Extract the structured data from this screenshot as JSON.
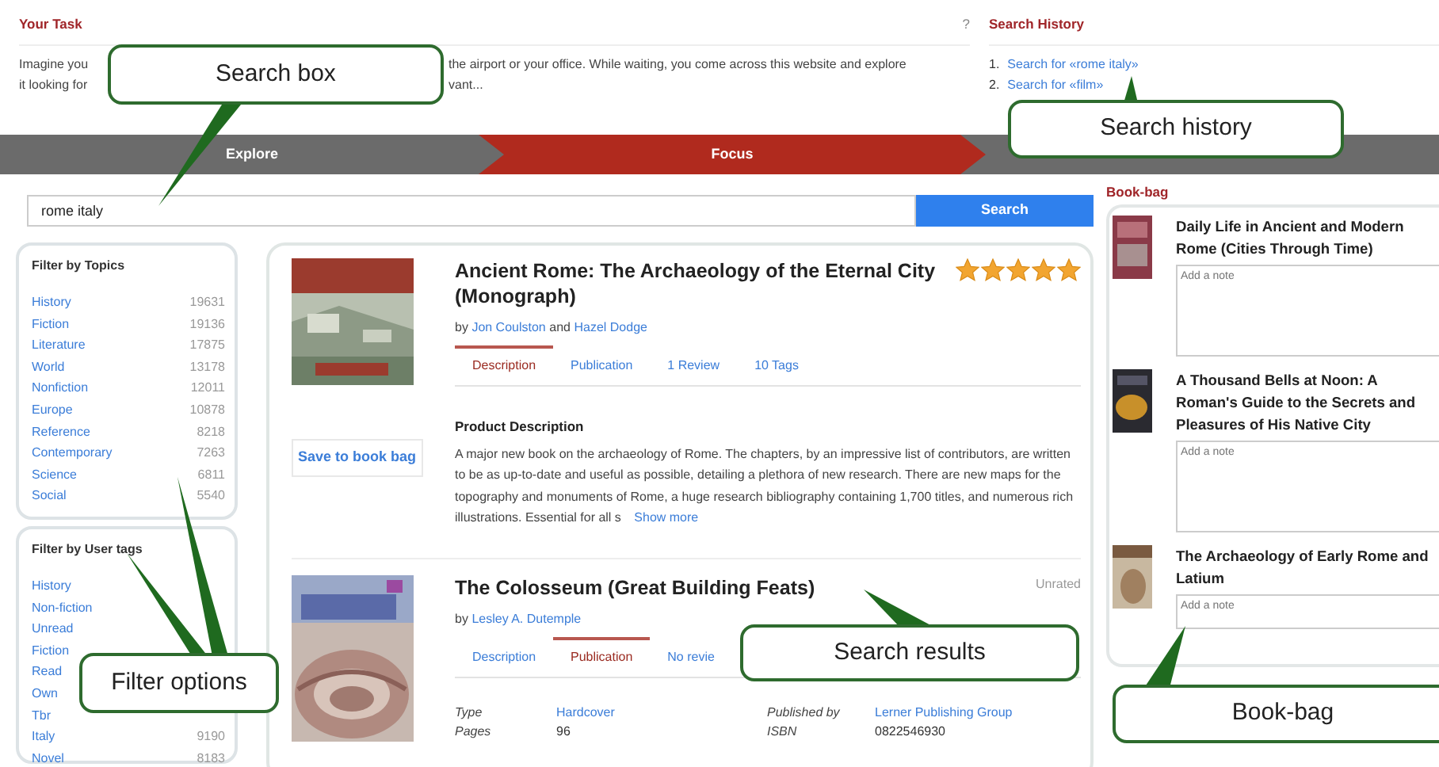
{
  "task": {
    "title": "Your Task",
    "help": "?",
    "lines": [
      {
        "before": "Imagine you",
        "after": "the airport or your office. While waiting, you come across this website and explore"
      },
      {
        "before": "it looking for",
        "after": "vant..."
      }
    ]
  },
  "search_history": {
    "title": "Search History",
    "items": [
      {
        "number": "1.",
        "label": "Search for «rome italy»"
      },
      {
        "number": "2.",
        "label": "Search for «film»"
      }
    ]
  },
  "steps": [
    {
      "label": "Explore",
      "selected": false
    },
    {
      "label": "Focus",
      "selected": true
    }
  ],
  "search": {
    "value": "rome italy",
    "button": "Search"
  },
  "filters": [
    {
      "title": "Filter by Topics",
      "items": [
        {
          "label": "History",
          "count": "19631"
        },
        {
          "label": "Fiction",
          "count": "19136"
        },
        {
          "label": "Literature",
          "count": "17875"
        },
        {
          "label": "World",
          "count": "13178"
        },
        {
          "label": "Nonfiction",
          "count": "12011"
        },
        {
          "label": "Europe",
          "count": "10878"
        },
        {
          "label": "Reference",
          "count": "8218"
        },
        {
          "label": "Contemporary",
          "count": "7263"
        },
        {
          "label": "Science",
          "count": "6811"
        },
        {
          "label": "Social",
          "count": "5540"
        }
      ]
    },
    {
      "title": "Filter by User tags",
      "items": [
        {
          "label": "History"
        },
        {
          "label": "Non-fiction"
        },
        {
          "label": "Unread"
        },
        {
          "label": "Fiction"
        },
        {
          "label": "Read"
        },
        {
          "label": "Own"
        },
        {
          "label": "Tbr"
        },
        {
          "label": "Italy",
          "count": "9190"
        },
        {
          "label": "Novel",
          "count": "8183"
        }
      ]
    }
  ],
  "results": [
    {
      "title": "Ancient Rome: The Archaeology of the Eternal City (Monograph)",
      "stars": 5,
      "by": "by",
      "authors": [
        "Jon Coulston",
        "Hazel Dodge"
      ],
      "joiner": "and",
      "save": "Save to book bag",
      "tabs": [
        {
          "label": "Description",
          "selected": true
        },
        {
          "label": "Publication",
          "selected": false
        },
        {
          "label": "1 Review",
          "selected": false
        },
        {
          "label": "10 Tags",
          "selected": false
        }
      ],
      "description": {
        "heading": "Product Description",
        "text": "A major new book on the archaeology of Rome. The chapters, by an impressive list of contributors, are written to be as up-to-date and useful as possible, detailing a plethora of new research. There are new maps for the topography and monuments of Rome, a huge research bibliography containing 1,700 titles, and numerous rich illustrations. Essential for all s",
        "more": "Show more"
      }
    },
    {
      "title": "The Colosseum (Great Building Feats)",
      "rating": "Unrated",
      "by": "by",
      "authors": [
        "Lesley A. Dutemple"
      ],
      "tabs": [
        {
          "label": "Description",
          "selected": false
        },
        {
          "label": "Publication",
          "selected": true
        },
        {
          "label": "No revie",
          "selected": false
        }
      ],
      "details": [
        {
          "label": "Type",
          "value": "Hardcover",
          "link": true
        },
        {
          "label": "Published by",
          "value": "Lerner Publishing Group",
          "link": true
        },
        {
          "label": "Pages",
          "value": "96",
          "link": false
        },
        {
          "label": "ISBN",
          "value": "0822546930",
          "link": false
        }
      ]
    }
  ],
  "book_bag": {
    "title": "Book-bag",
    "items": [
      {
        "title": "Daily Life in Ancient and Modern Rome (Cities Through Time)",
        "placeholder": "Add a note"
      },
      {
        "title": "A Thousand Bells at Noon: A Roman's Guide to the Secrets and Pleasures of His Native City",
        "placeholder": "Add a note"
      },
      {
        "title": "The Archaeology of Early Rome and Latium",
        "placeholder": "Add a note"
      }
    ]
  },
  "annotations": [
    {
      "label": "Search box"
    },
    {
      "label": "Search history"
    },
    {
      "label": "Filter options"
    },
    {
      "label": "Search results"
    },
    {
      "label": "Book-bag"
    }
  ]
}
